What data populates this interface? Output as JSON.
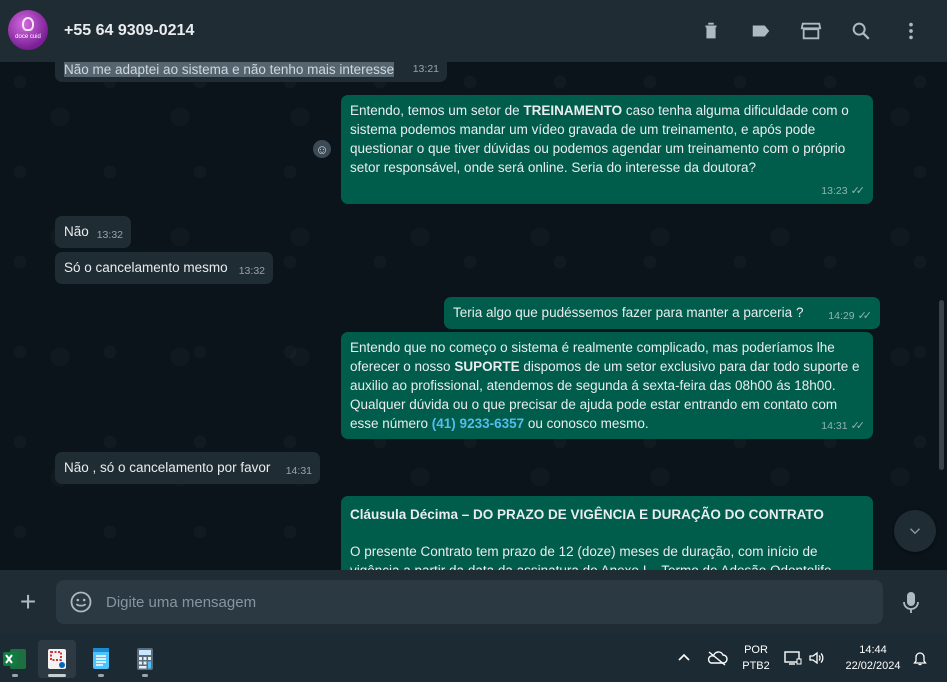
{
  "header": {
    "contact_name": "+55 64 9309-0214",
    "avatar_text": "doce cuid"
  },
  "messages": [
    {
      "dir": "in",
      "text": "Não me adaptei ao sistema e não tenho mais interesse",
      "time": "13:21"
    },
    {
      "dir": "out",
      "time": "13:23"
    },
    {
      "dir": "in",
      "text": "Não",
      "time": "13:32"
    },
    {
      "dir": "in",
      "text": "Só o cancelamento mesmo",
      "time": "13:32"
    },
    {
      "dir": "out",
      "text": "Teria algo que pudéssemos fazer para manter a parceria ?",
      "time": "14:29"
    },
    {
      "dir": "out",
      "time": "14:31"
    },
    {
      "dir": "in",
      "text": "Não , só o cancelamento por favor",
      "time": "14:31"
    }
  ],
  "msg_treinamento": {
    "p1": "Entendo, temos um setor de ",
    "strong": "TREINAMENTO",
    "p2": " caso tenha alguma dificuldade com o sistema podemos mandar um vídeo gravada de um treinamento, e após pode questionar o que tiver dúvidas ou podemos agendar um treinamento com o próprio setor responsável, onde será online. Seria do interesse da doutora?"
  },
  "msg_suporte": {
    "p1": "Entendo que no começo o sistema é realmente complicado, mas poderíamos lhe oferecer o nosso ",
    "strong": "SUPORTE",
    "p2": " dispomos de um setor exclusivo para dar todo suporte e auxilio ao profissional, atendemos de segunda á sexta-feira das 08h00 ás 18h00. Qualquer dúvida ou o que precisar de ajuda pode estar entrando em contato com esse número ",
    "phone": "(41) 9233-6357",
    "p3": " ou conosco mesmo."
  },
  "msg_contrato": {
    "title": "Cláusula Décima – DO PRAZO DE VIGÊNCIA E DURAÇÃO DO CONTRATO",
    "body": "O presente Contrato tem prazo de 12 (doze) meses de duração, com início de vigência a partir da data da assinatura do Anexo I – Termo de Adesão Odontolife"
  },
  "composer": {
    "placeholder": "Digite uma mensagem"
  },
  "taskbar": {
    "lang_top": "POR",
    "lang_bottom": "PTB2",
    "time": "14:44",
    "date": "22/02/2024"
  },
  "colors": {
    "outgoing_bubble": "#005c4b",
    "incoming_bubble": "#202c33",
    "link": "#53bdeb"
  }
}
